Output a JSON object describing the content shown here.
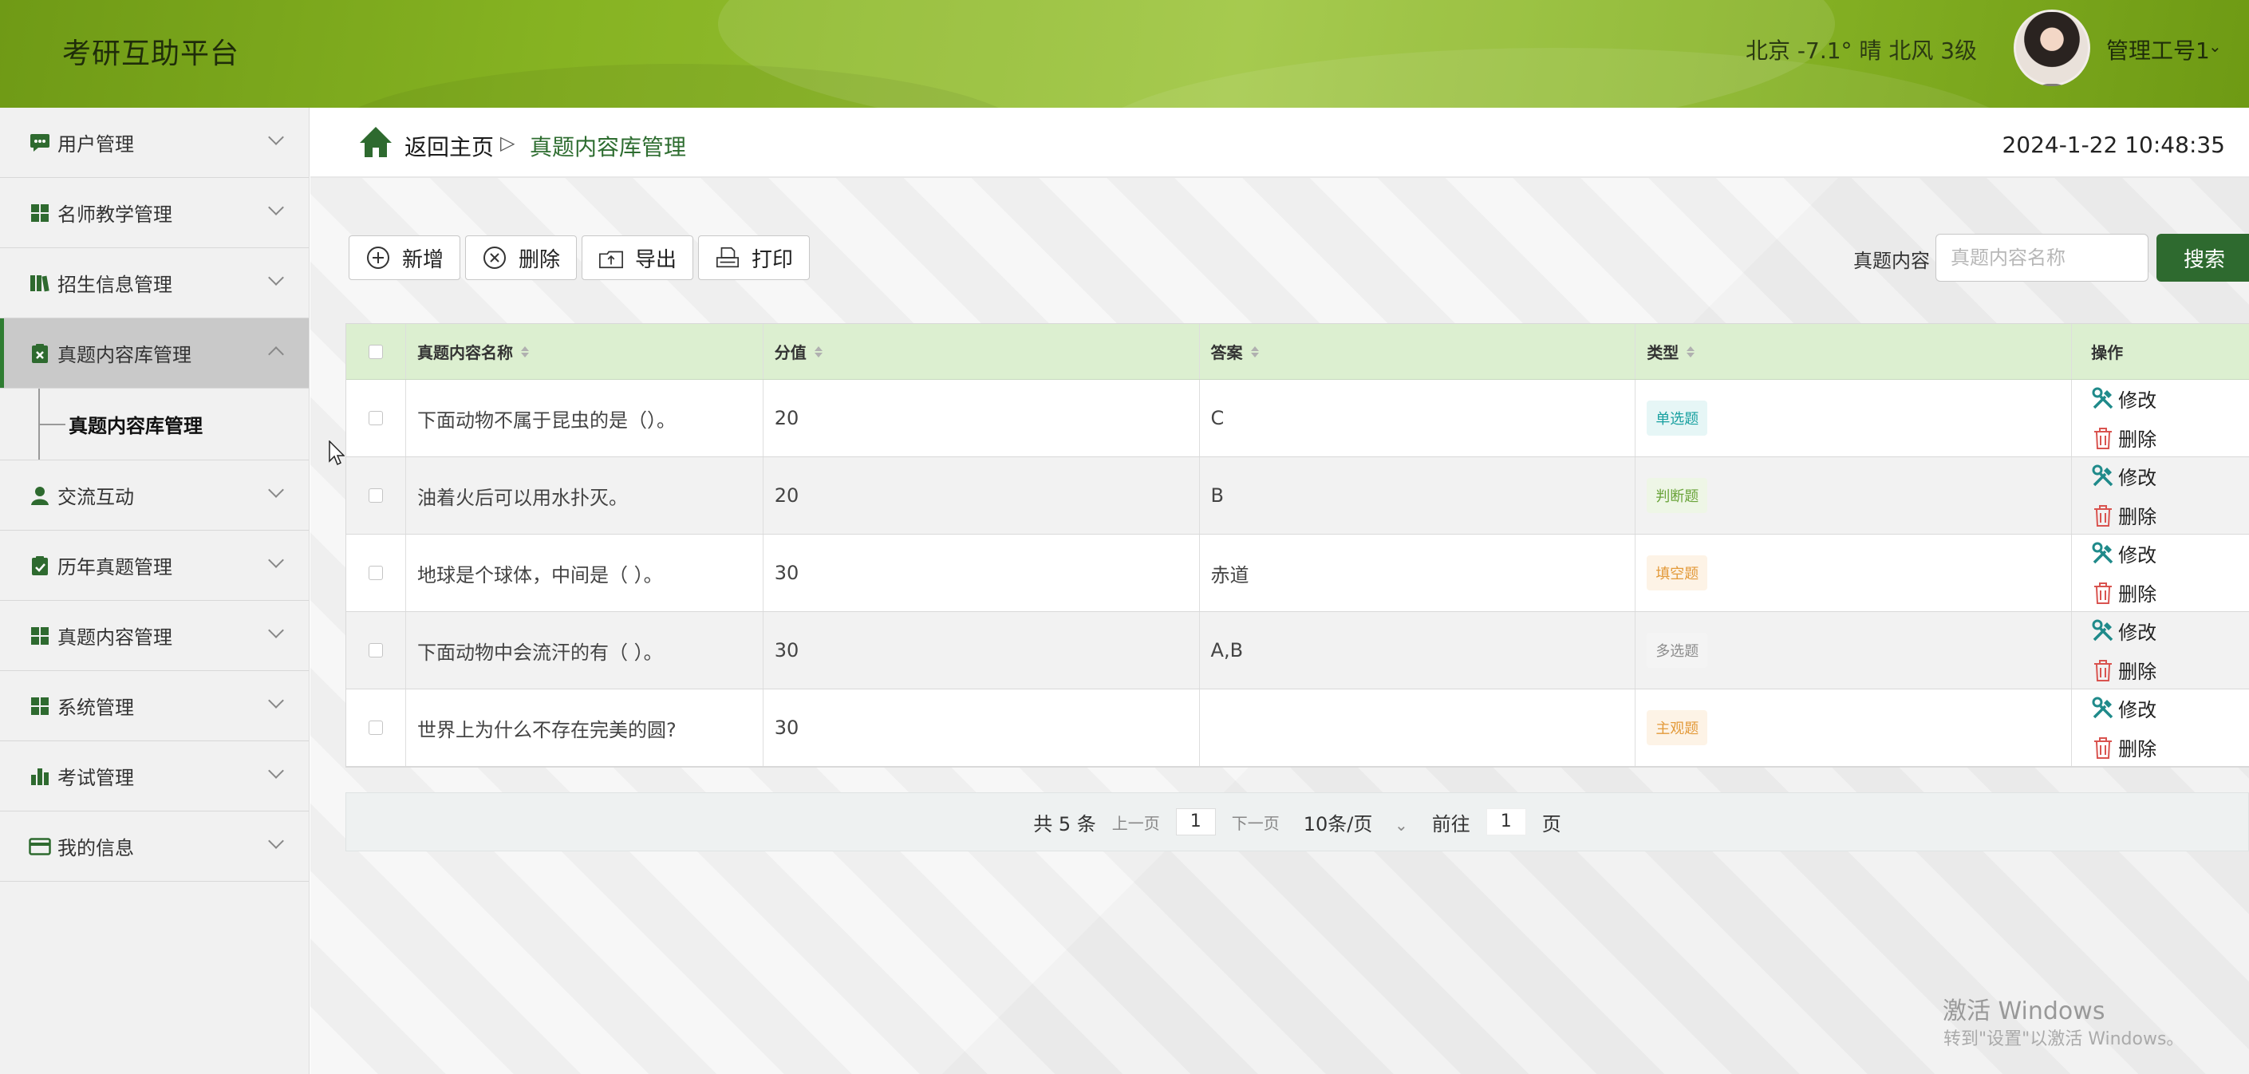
{
  "header": {
    "app_title": "考研互助平台",
    "weather": "北京  -7.1°  晴  北风  3级",
    "user_name": "管理工号1",
    "user_caret": "⌄"
  },
  "sidebar": {
    "items": [
      {
        "label": "用户管理",
        "icon": "chat-icon",
        "expanded": false
      },
      {
        "label": "名师教学管理",
        "icon": "grid-icon",
        "expanded": false
      },
      {
        "label": "招生信息管理",
        "icon": "book-icon",
        "expanded": false
      },
      {
        "label": "真题内容库管理",
        "icon": "clipboard-icon",
        "expanded": true,
        "active": true
      },
      {
        "label": "交流互动",
        "icon": "user-icon",
        "expanded": false
      },
      {
        "label": "历年真题管理",
        "icon": "clipboard-check-icon",
        "expanded": false
      },
      {
        "label": "真题内容管理",
        "icon": "grid-icon",
        "expanded": false
      },
      {
        "label": "系统管理",
        "icon": "grid-icon",
        "expanded": false
      },
      {
        "label": "考试管理",
        "icon": "bar-chart-icon",
        "expanded": false
      },
      {
        "label": "我的信息",
        "icon": "card-icon",
        "expanded": false
      }
    ],
    "sub_item": "真题内容库管理"
  },
  "breadcrumb": {
    "home": "返回主页",
    "separator": "▷",
    "current": "真题内容库管理"
  },
  "clock": "2024-1-22 10:48:35",
  "toolbar": {
    "add": "新增",
    "delete": "删除",
    "export": "导出",
    "print": "打印"
  },
  "search": {
    "label": "真题内容",
    "placeholder": "真题内容名称",
    "button": "搜索"
  },
  "table": {
    "columns": [
      "真题内容名称",
      "分值",
      "答案",
      "类型",
      "操作"
    ],
    "rows": [
      {
        "name": "下面动物不属于昆虫的是（）。",
        "score": "20",
        "answer": "C",
        "type": "单选题",
        "type_color": "#18a0a0",
        "type_bg": "#e6f6f6"
      },
      {
        "name": "油着火后可以用水扑灭。",
        "score": "20",
        "answer": "B",
        "type": "判断题",
        "type_color": "#6aa43a",
        "type_bg": "#eef6e6"
      },
      {
        "name": "地球是个球体，中间是（ ）。",
        "score": "30",
        "answer": "赤道",
        "type": "填空题",
        "type_color": "#e39a3a",
        "type_bg": "#fdf3e6"
      },
      {
        "name": "下面动物中会流汗的有（ ）。",
        "score": "30",
        "answer": "A,B",
        "type": "多选题",
        "type_color": "#8c8c8c",
        "type_bg": "#f4f4f4"
      },
      {
        "name": "世界上为什么不存在完美的圆?",
        "score": "30",
        "answer": "",
        "type": "主观题",
        "type_color": "#e39a3a",
        "type_bg": "#fdf3e6"
      }
    ],
    "edit_label": "修改",
    "delete_label": "删除"
  },
  "pager": {
    "total": "共 5 条",
    "prev": "上一页",
    "page": "1",
    "next": "下一页",
    "page_size": "10条/页",
    "size_caret": "⌄",
    "goto_label": "前往",
    "goto_page": "1",
    "goto_unit": "页"
  },
  "watermark": {
    "line1": "激活 Windows",
    "line2": "转到\"设置\"以激活 Windows。"
  },
  "colors": {
    "accent": "#2e6a2f",
    "header_green": "#86b322",
    "table_head": "#dcefd0"
  }
}
